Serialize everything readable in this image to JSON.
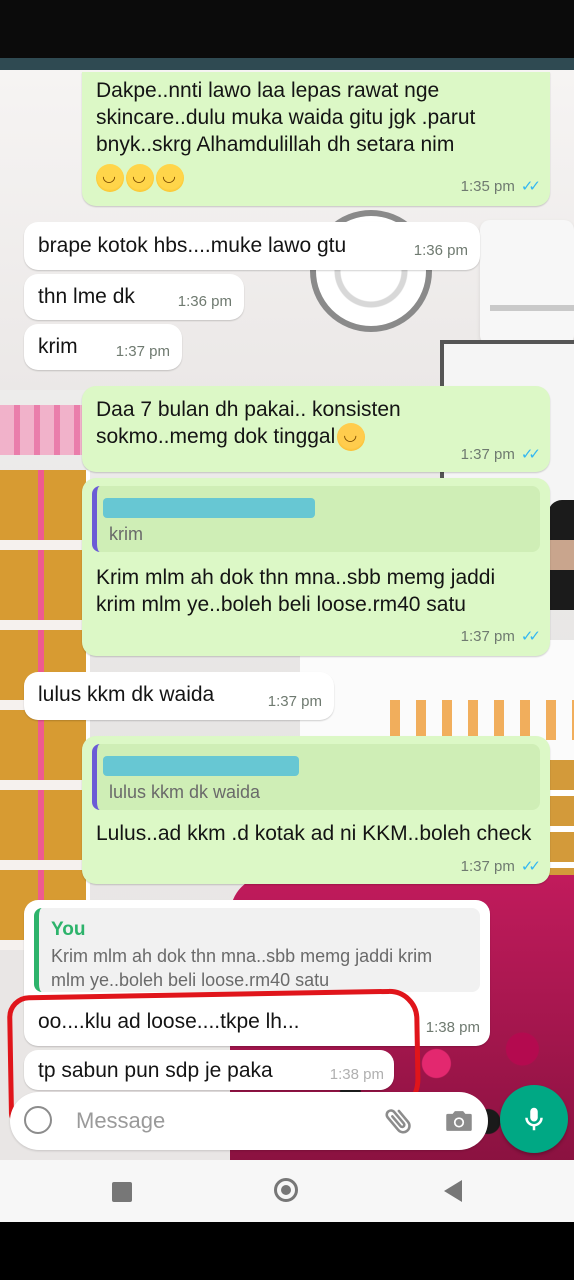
{
  "messages": [
    {
      "dir": "out",
      "text": "Dakpe..nnti lawo laa lepas rawat nge skincare..dulu muka waida gitu jgk .parut bnyk..skrg Alhamdulillah dh setara nim",
      "time": "1:35 pm"
    },
    {
      "dir": "in",
      "text": "brape kotok hbs....muke lawo gtu",
      "time": "1:36 pm"
    },
    {
      "dir": "in",
      "text": "thn lme dk",
      "time": "1:36 pm"
    },
    {
      "dir": "in",
      "text": "krim",
      "time": "1:37 pm"
    },
    {
      "dir": "out",
      "text": "Daa 7 bulan dh pakai.. konsisten sokmo..memg dok tinggal",
      "time": "1:37 pm"
    },
    {
      "dir": "out",
      "quote": "krim",
      "text": "Krim mlm ah dok thn mna..sbb memg jaddi krim mlm ye..boleh beli loose.rm40 satu",
      "time": "1:37 pm"
    },
    {
      "dir": "in",
      "text": "lulus kkm dk waida",
      "time": "1:37 pm"
    },
    {
      "dir": "out",
      "quote": "lulus kkm dk waida",
      "text": "Lulus..ad kkm .d kotak ad ni KKM..boleh check",
      "time": "1:37 pm"
    },
    {
      "dir": "in",
      "quote_author": "You",
      "quote": "Krim mlm ah dok thn mna..sbb memg jaddi krim mlm ye..boleh beli loose.rm40 satu",
      "text": "oo....klu ad loose....tkpe lh...",
      "time": "1:38 pm"
    },
    {
      "dir": "in",
      "text": "tp sabun pun sdp je paka",
      "time": "1:38 pm"
    }
  ],
  "composer": {
    "placeholder": "Message"
  },
  "icons": {
    "emoji": "emoji-icon",
    "attach": "paperclip-icon",
    "camera": "camera-icon",
    "mic": "microphone-icon"
  },
  "colors": {
    "outgoing": "#dcf8c6",
    "incoming": "#ffffff",
    "accent": "#00a884",
    "read_ticks": "#34b7f1",
    "annotation": "#e0151b"
  }
}
